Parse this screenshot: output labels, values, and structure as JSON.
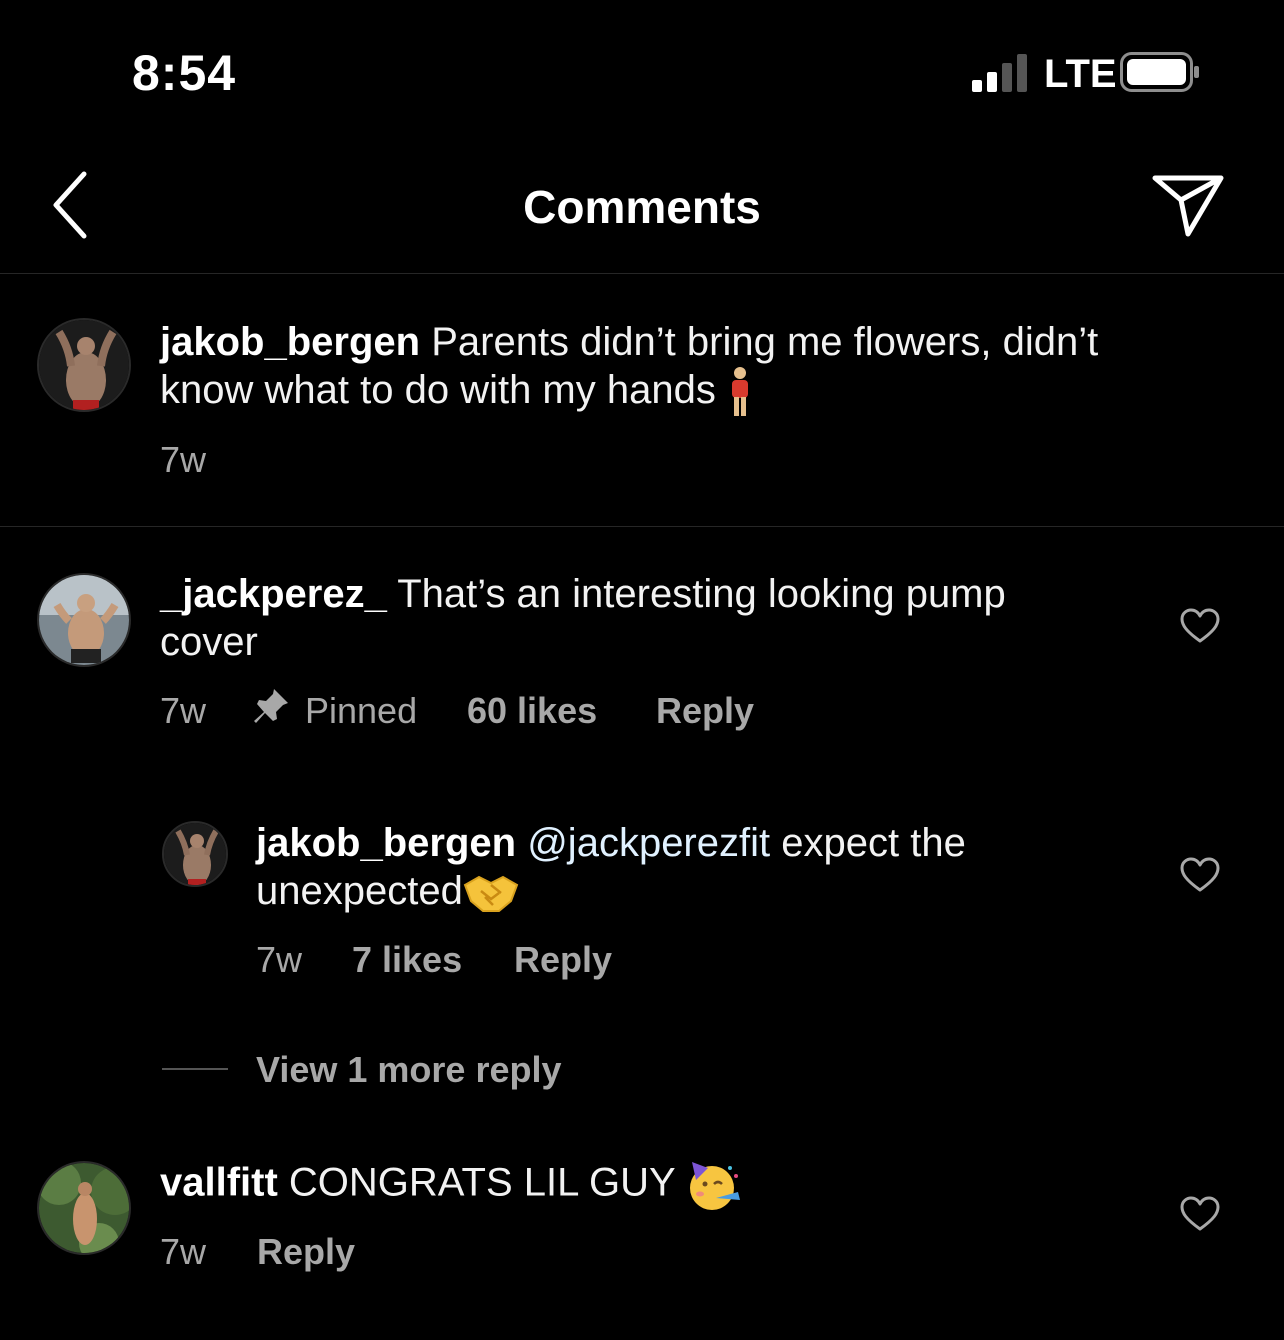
{
  "status_bar": {
    "time": "8:54",
    "network": "LTE"
  },
  "header": {
    "title": "Comments",
    "back_icon": "chevron-left-icon",
    "send_icon": "paper-plane-icon"
  },
  "caption": {
    "username": "jakob_bergen",
    "text_line1": "Parents didn’t bring me flowers, didn’t",
    "text_line2": "know what to do with my hands",
    "emoji": "person-standing-emoji",
    "time": "7w"
  },
  "comments": [
    {
      "username": "_jackperez_",
      "text_line1": "That’s an interesting looking pump",
      "text_line2": "cover",
      "time": "7w",
      "pinned": "Pinned",
      "likes": "60 likes",
      "reply": "Reply"
    },
    {
      "username": "jakob_bergen",
      "mention": "@jackperezfit",
      "text_line1": "expect the",
      "text_line2": "unexpected",
      "emoji": "handshake-emoji",
      "time": "7w",
      "likes": "7 likes",
      "reply": "Reply"
    },
    {
      "username": "vallfitt",
      "text_line1": "CONGRATS LIL GUY",
      "emoji": "partying-face-emoji",
      "time": "7w",
      "reply": "Reply"
    }
  ],
  "view_more": "View 1 more reply",
  "colors": {
    "background": "#000000",
    "text": "#ffffff",
    "secondary": "#a8a8a8",
    "divider": "#262626",
    "mention": "#e0f1ff"
  }
}
